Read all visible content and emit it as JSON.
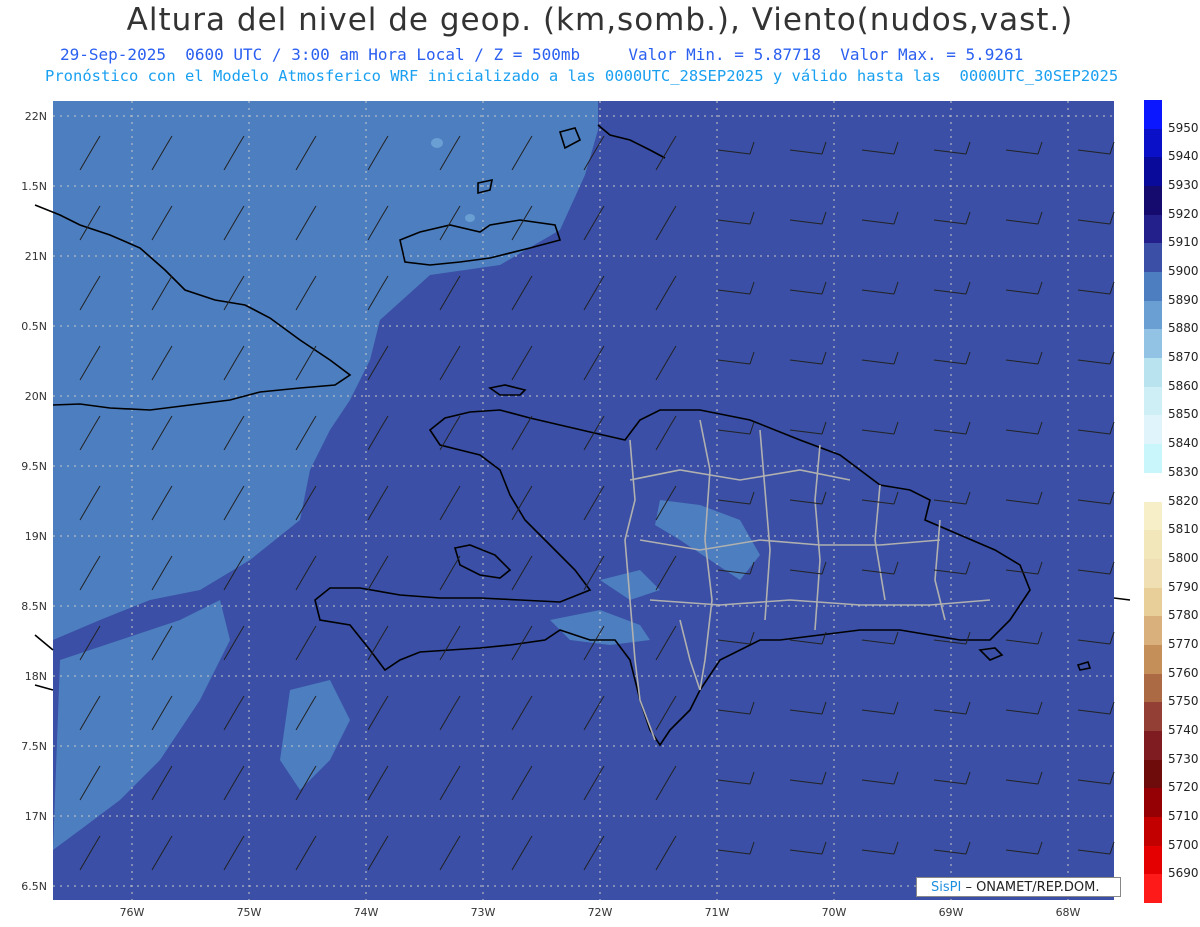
{
  "title": "Altura del nivel de geop. (km,somb.), Viento(nudos,vast.)",
  "subtitle_line1": "29-Sep-2025  0600 UTC / 3:00 am Hora Local / Z = 500mb     Valor Min. = 5.87718  Valor Max. = 5.9261",
  "subtitle_line2": "Pronóstico con el Modelo Atmosferico WRF inicializado a las 0000UTC_28SEP2025 y válido hasta las  0000UTC_30SEP2025",
  "latitude_labels": [
    "22N",
    "1.5N",
    "21N",
    "0.5N",
    "20N",
    "9.5N",
    "19N",
    "8.5N",
    "18N",
    "7.5N",
    "17N",
    "6.5N"
  ],
  "longitude_labels": [
    "76W",
    "75W",
    "74W",
    "73W",
    "72W",
    "71W",
    "70W",
    "69W",
    "68W"
  ],
  "legend": {
    "levels": [
      5950,
      5940,
      5930,
      5920,
      5910,
      5900,
      5890,
      5880,
      5870,
      5860,
      5850,
      5840,
      5830,
      5820,
      5810,
      5800,
      5790,
      5780,
      5770,
      5760,
      5750,
      5740,
      5730,
      5720,
      5710,
      5700,
      5690
    ],
    "colors": [
      "#0b17ff",
      "#0a10c8",
      "#09099a",
      "#150a6e",
      "#23208c",
      "#3a4fa5",
      "#4d7ebf",
      "#6a9fd4",
      "#92c3e4",
      "#b8e3ef",
      "#cdeff5",
      "#dff5fb",
      "#c8f6fb",
      "#ffffff",
      "#f7efc8",
      "#f2e6bb",
      "#efdfb2",
      "#e8cf99",
      "#d9b07c",
      "#c58f5a",
      "#ab6a44",
      "#933f36",
      "#7e1c22",
      "#6e0c0c",
      "#950005",
      "#c20000",
      "#e40000",
      "#ff1a1a"
    ]
  },
  "footer": {
    "brand": "SisPI",
    "text": " – ONAMET/REP.DOM."
  },
  "colors": {
    "background_field": "#3a4fa5",
    "higher_field": "#4d7ebf",
    "coast": "#000000",
    "provinces": "#b0b0b0"
  }
}
